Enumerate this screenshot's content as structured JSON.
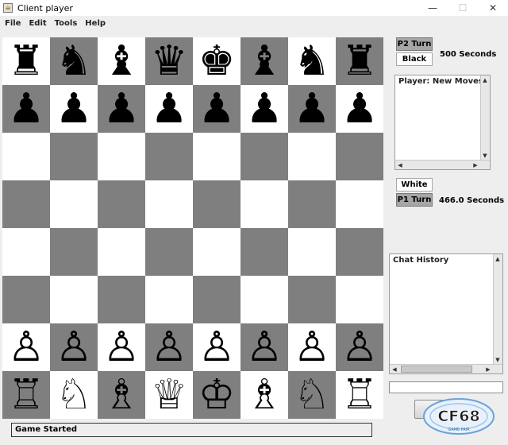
{
  "window": {
    "title": "Client player",
    "icon": "java-cup-icon"
  },
  "window_controls": {
    "minimize": "—",
    "maximize": "☐",
    "close": "✕"
  },
  "menu": [
    "File",
    "Edit",
    "Tools",
    "Help"
  ],
  "board": {
    "light_color": "#ffffff",
    "dark_color": "#7f7f7f",
    "rows": [
      [
        "♜",
        "♞",
        "♝",
        "♛",
        "♚",
        "♝",
        "♞",
        "♜"
      ],
      [
        "♟",
        "♟",
        "♟",
        "♟",
        "♟",
        "♟",
        "♟",
        "♟"
      ],
      [
        "",
        "",
        "",
        "",
        "",
        "",
        "",
        ""
      ],
      [
        "",
        "",
        "",
        "",
        "",
        "",
        "",
        ""
      ],
      [
        "",
        "",
        "",
        "",
        "",
        "",
        "",
        ""
      ],
      [
        "",
        "",
        "",
        "",
        "",
        "",
        "",
        ""
      ],
      [
        "♙",
        "♙",
        "♙",
        "♙",
        "♙",
        "♙",
        "♙",
        "♙"
      ],
      [
        "♖",
        "♘",
        "♗",
        "♕",
        "♔",
        "♗",
        "♘",
        "♖"
      ]
    ]
  },
  "player2": {
    "turn_label": "P2 Turn",
    "color_label": "Black",
    "time": "500 Seconds"
  },
  "moves_panel": {
    "title": "Player: New Moves"
  },
  "player1": {
    "color_label": "White",
    "turn_label": "P1 Turn",
    "time": "466.0 Seconds"
  },
  "chat": {
    "title": "Chat History",
    "input_value": ""
  },
  "status": {
    "text": "Game Started"
  },
  "watermark": {
    "text": "CF68",
    "subtext": "GAME FAIR"
  }
}
